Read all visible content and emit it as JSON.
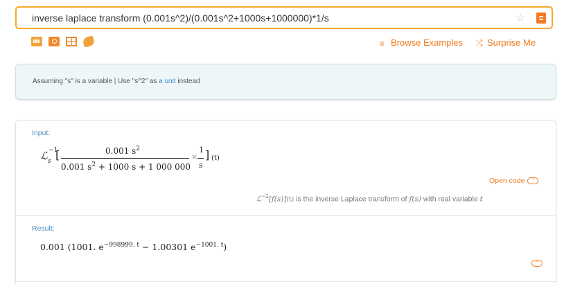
{
  "search": {
    "query": "inverse laplace transform (0.001s^2)/(0.001s^2+1000s+1000000)*1/s",
    "star_glyph": "☆"
  },
  "toolbar": {
    "icons": [
      "keyboard-icon",
      "camera-icon",
      "table-icon",
      "hand-icon"
    ],
    "browse_label": "Browse Examples",
    "surprise_label": "Surprise Me",
    "browse_glyph": "≡",
    "surprise_glyph": "⤮"
  },
  "assumption": {
    "prefix": "Assuming \"s\" is a variable | Use \"s^2\" as ",
    "link": "a unit",
    "suffix": " instead"
  },
  "input_pod": {
    "title": "Input:",
    "laplace_symbol": "ℒ",
    "sup": "−1",
    "sub": "s",
    "numerator": "0.001 s",
    "numerator_exp": "2",
    "denominator_a": "0.001 s",
    "denominator_exp": "2",
    "denominator_b": "+ 1000 s + 1 000 000",
    "times": "×",
    "frac2_num": "1",
    "frac2_den": "s",
    "arg": "(t)",
    "open_code": "Open code",
    "note_fs": "[f(s)]",
    "note_t": "(t)",
    "note_text": " is the inverse Laplace transform of ",
    "note_f": "f(s)",
    "note_end": " with real variable ",
    "note_var": "t"
  },
  "result_pod": {
    "title": "Result:",
    "coef": "0.001 (1001. e",
    "exp1": "−998999. t",
    "minus": " − 1.00301 e",
    "exp2": "−1001. t",
    "close": ")"
  },
  "colors": {
    "accent": "#f47b20",
    "search_border": "#f7a928",
    "link_blue": "#3b8bc9",
    "assume_bg": "#eef6f8"
  }
}
